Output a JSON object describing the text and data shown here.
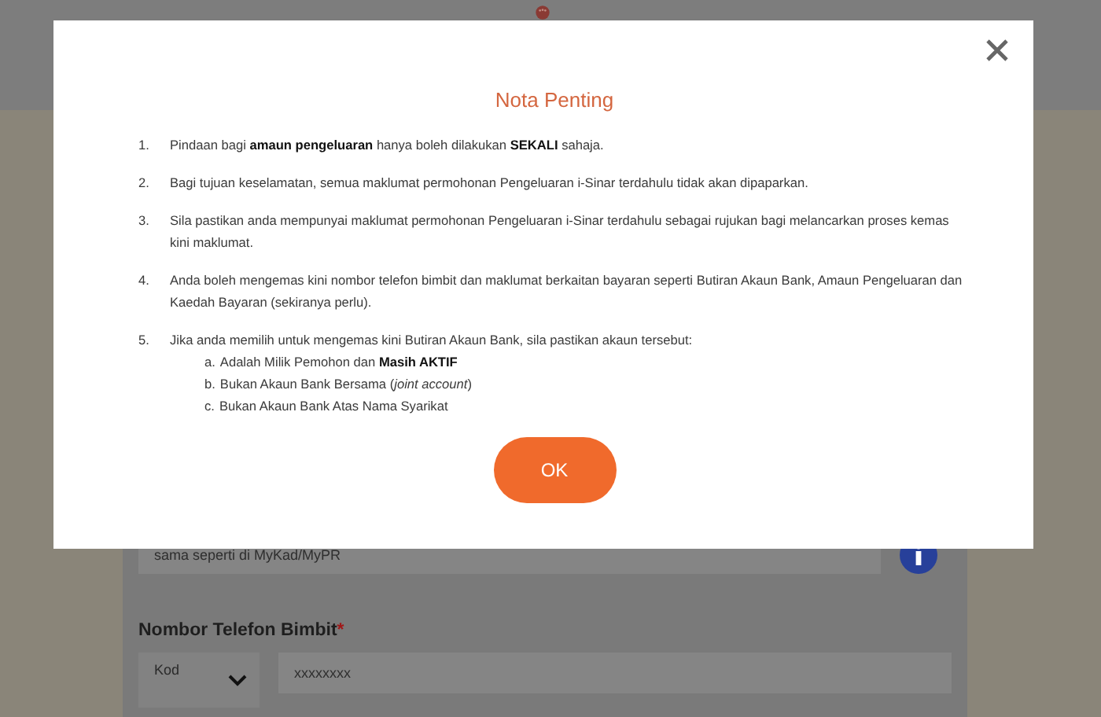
{
  "background_form": {
    "id_field": {
      "placeholder": "sama seperti di MyKad/MyPR"
    },
    "phone_label": "Nombor Telefon Bimbit",
    "required_mark": "*",
    "code_select": {
      "value": "Kod"
    },
    "phone_field": {
      "placeholder": "xxxxxxxx"
    }
  },
  "dialog": {
    "title": "Nota Penting",
    "items": [
      {
        "number": "1.",
        "text": "Pindaan bagi **amaun pengeluaran** hanya boleh dilakukan **SEKALI** sahaja."
      },
      {
        "number": "2.",
        "text": "Bagi tujuan keselamatan, semua maklumat permohonan Pengeluaran i-Sinar terdahulu tidak akan dipaparkan."
      },
      {
        "number": "3.",
        "text": "Sila pastikan anda mempunyai maklumat permohonan Pengeluaran i-Sinar terdahulu sebagai rujukan bagi melancarkan proses kemas kini maklumat."
      },
      {
        "number": "4.",
        "text": "Anda boleh mengemas kini nombor telefon bimbit dan maklumat berkaitan bayaran seperti Butiran Akaun Bank, Amaun Pengeluaran dan Kaedah Bayaran (sekiranya perlu)."
      },
      {
        "number": "5.",
        "text": "Jika anda memilih untuk mengemas kini Butiran Akaun Bank, sila pastikan akaun tersebut:",
        "children": [
          {
            "number": "a.",
            "text": "Adalah Milik Pemohon dan **Masih AKTIF**"
          },
          {
            "number": "b.",
            "text": "Bukan Akaun Bank Bersama (*joint account*)"
          },
          {
            "number": "c.",
            "text": "Bukan Akaun Bank Atas Nama Syarikat"
          }
        ]
      }
    ],
    "button": "OK"
  }
}
